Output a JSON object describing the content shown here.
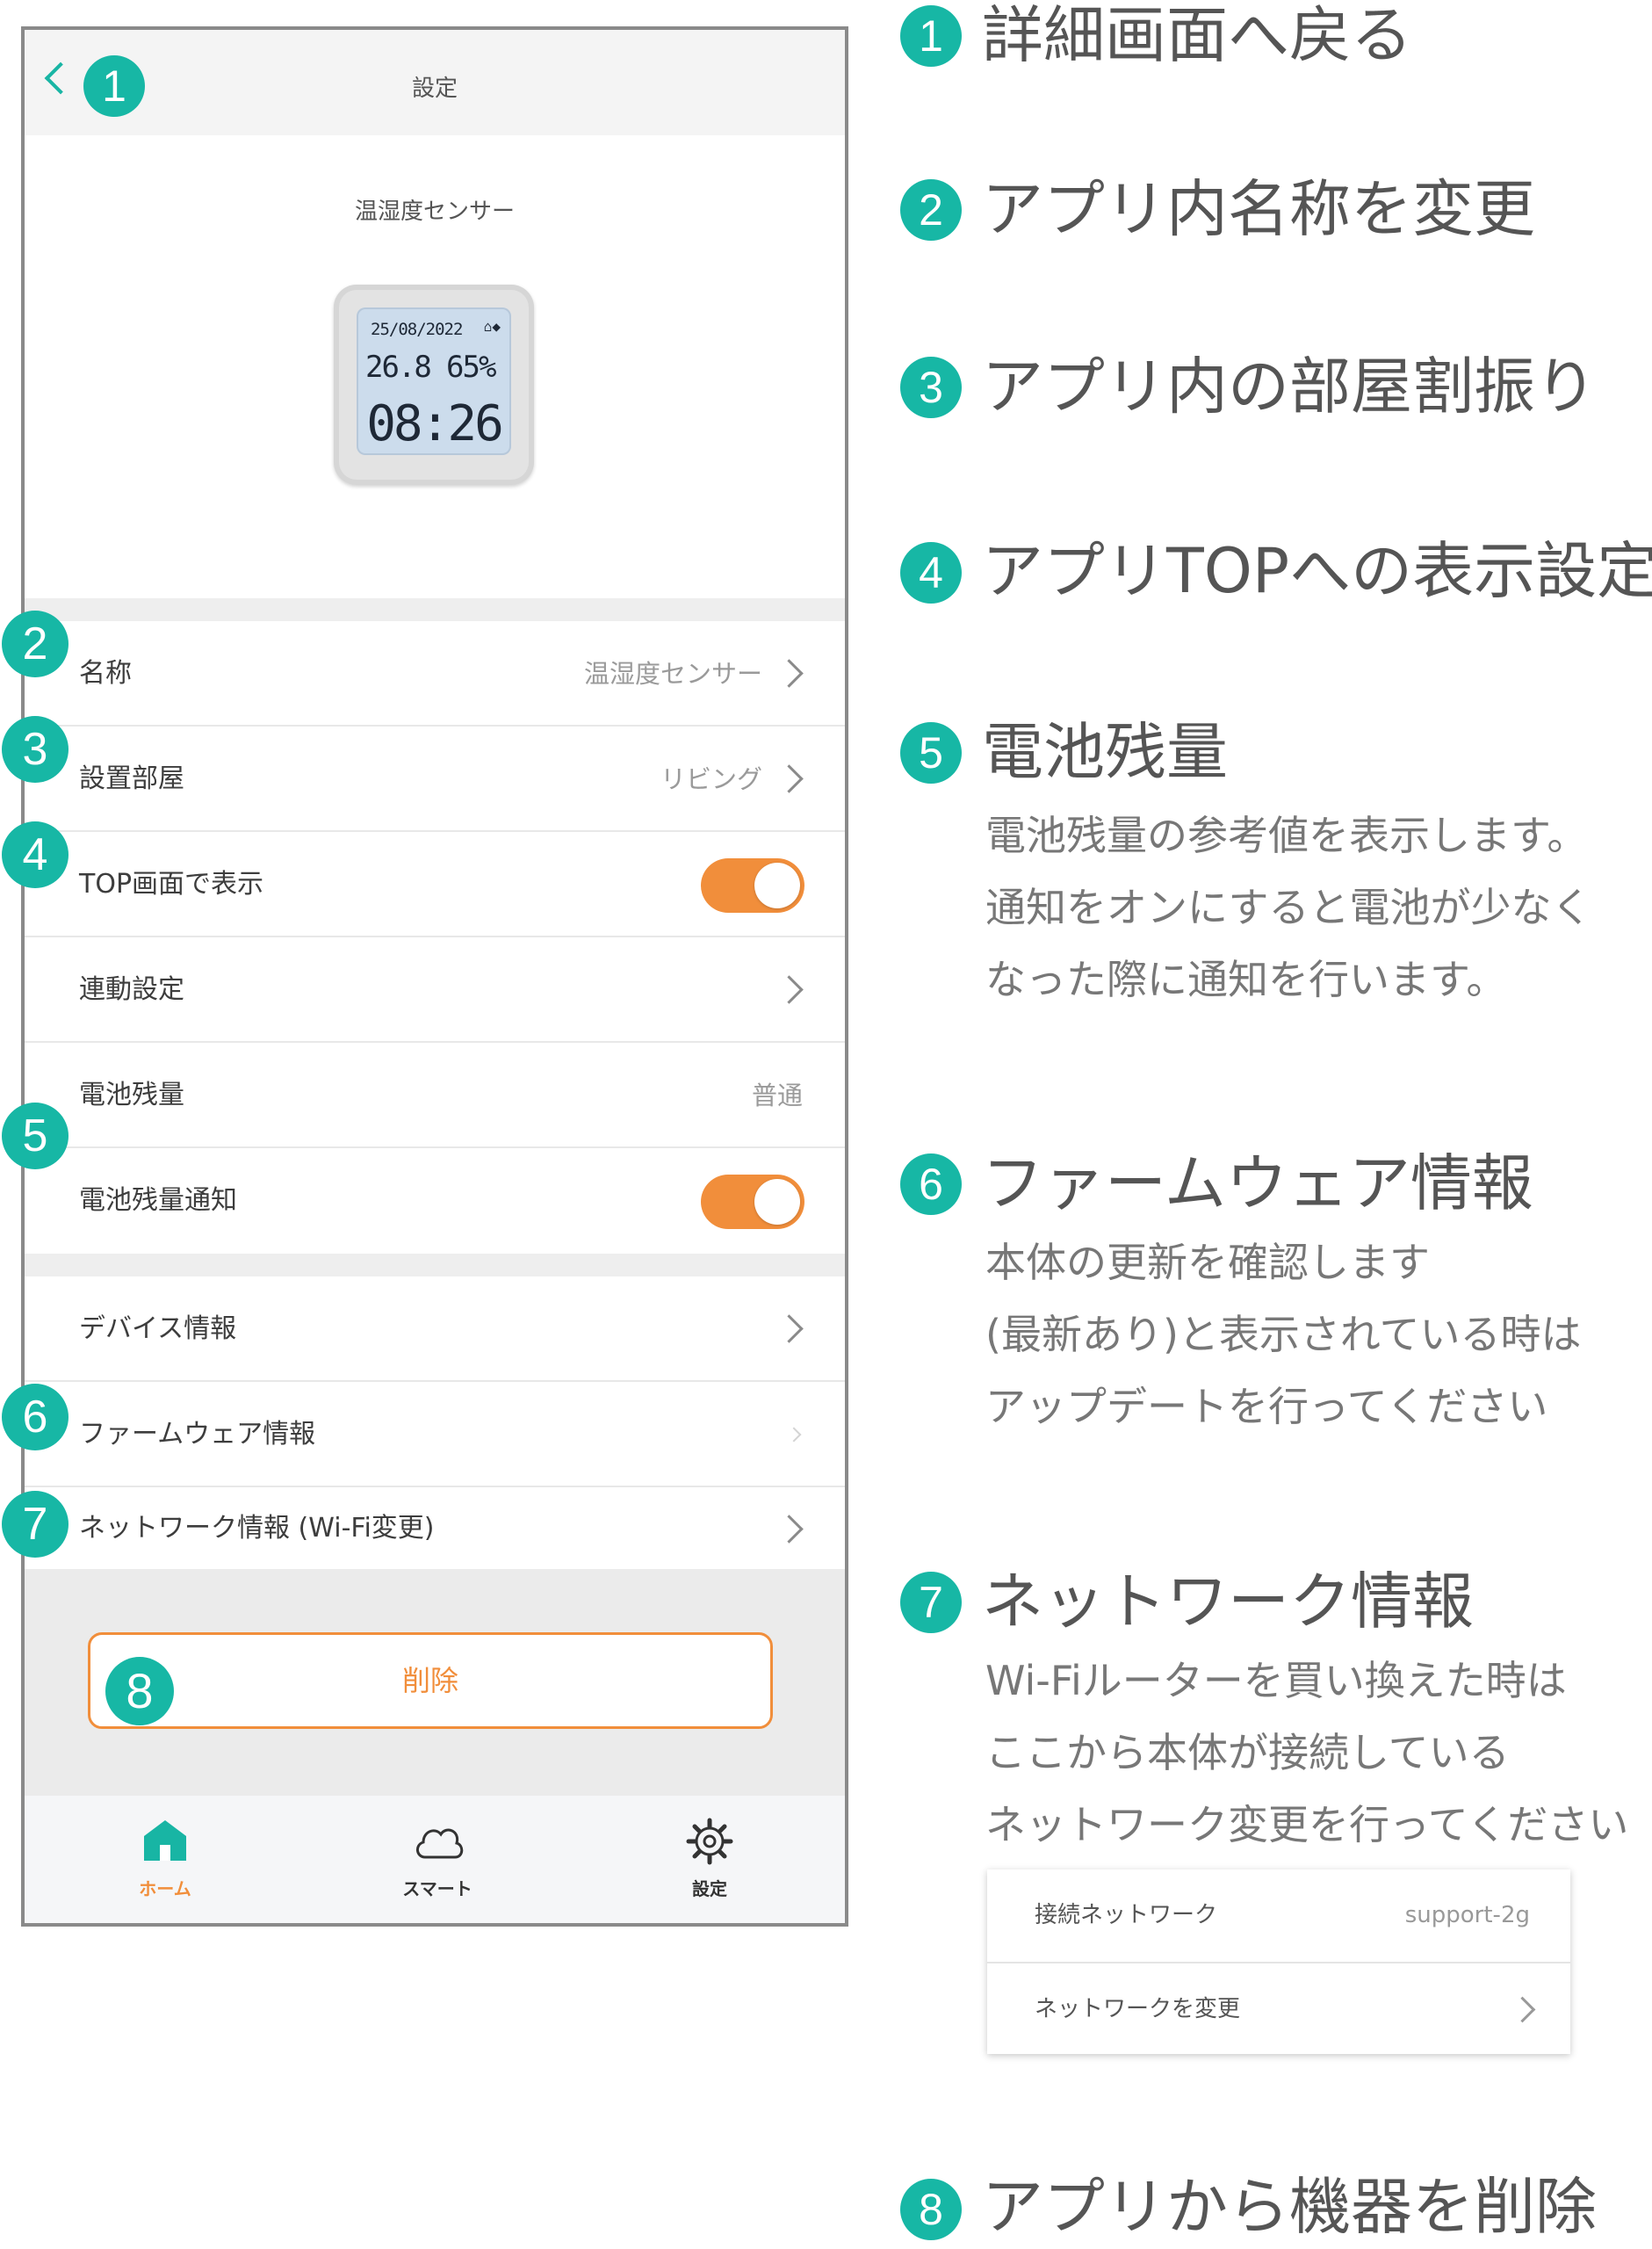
{
  "header": {
    "title": "設定"
  },
  "device": {
    "name": "温湿度センサー",
    "lcd": {
      "date": "25/08/2022",
      "temp": "26.8",
      "humidity": "65%",
      "time": "08:26"
    }
  },
  "settings": {
    "name_label": "名称",
    "name_value": "温湿度センサー",
    "room_label": "設置部屋",
    "room_value": "リビング",
    "top_label": "TOP画面で表示",
    "linkage_label": "連動設定",
    "battery_label": "電池残量",
    "battery_value": "普通",
    "battery_notify_label": "電池残量通知",
    "device_info_label": "デバイス情報",
    "firmware_label": "ファームウェア情報",
    "network_label": "ネットワーク情報 (Wi-Fi変更)",
    "delete_label": "削除"
  },
  "toggles": {
    "top_display": true,
    "battery_notify": true
  },
  "tabbar": {
    "home": "ホーム",
    "smart": "スマート",
    "settings": "設定"
  },
  "badges": [
    "1",
    "2",
    "3",
    "4",
    "5",
    "6",
    "7",
    "8"
  ],
  "annotations": {
    "a1": {
      "title": "詳細画面へ戻る"
    },
    "a2": {
      "title": "アプリ内名称を変更"
    },
    "a3": {
      "title": "アプリ内の部屋割振り"
    },
    "a4": {
      "title": "アプリTOPへの表示設定"
    },
    "a5": {
      "title": "電池残量",
      "lines": [
        "電池残量の参考値を表示します。",
        "通知をオンにすると電池が少なく",
        "なった際に通知を行います。"
      ]
    },
    "a6": {
      "title": "ファームウェア情報",
      "lines": [
        "本体の更新を確認します",
        "(最新あり)と表示されている時は",
        "アップデートを行ってください"
      ]
    },
    "a7": {
      "title": "ネットワーク情報",
      "lines": [
        "Wi-Fiルーターを買い換えた時は",
        "ここから本体が接続している",
        "ネットワーク変更を行ってください"
      ]
    },
    "a8": {
      "title": "アプリから機器を削除"
    }
  },
  "network_card": {
    "connected_label": "接続ネットワーク",
    "connected_value": "support-2g",
    "change_label": "ネットワークを変更"
  },
  "colors": {
    "accent_teal": "#17b7a5",
    "accent_orange": "#f18e3b"
  }
}
